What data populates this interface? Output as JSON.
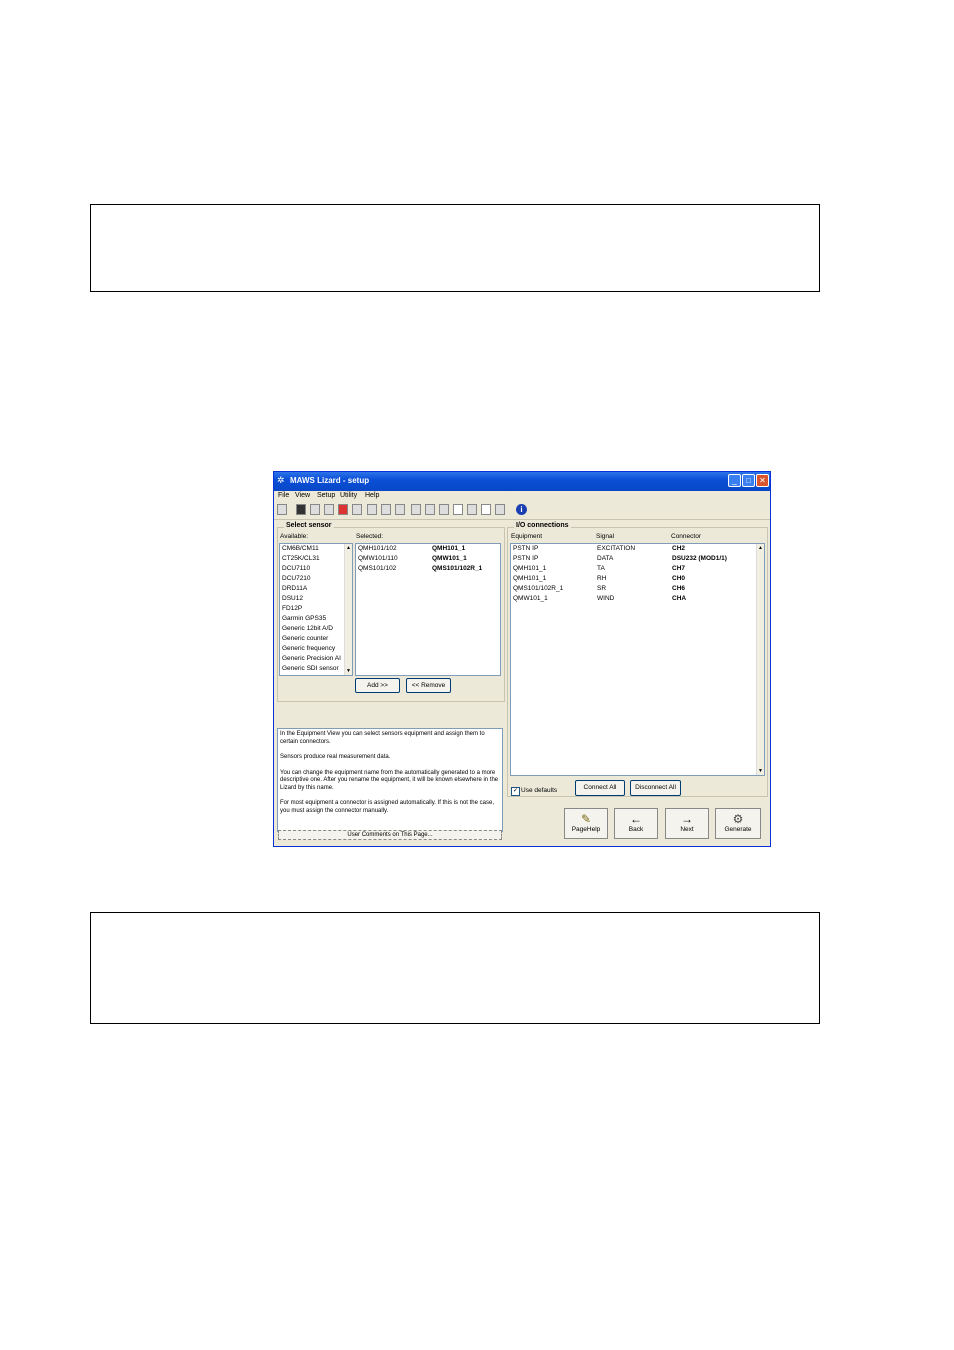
{
  "window": {
    "title": "MAWS Lizard - setup",
    "menu": [
      "File",
      "View",
      "Setup",
      "Utility",
      "Help"
    ],
    "info_icon": "i"
  },
  "select_sensor": {
    "title": "Select sensor",
    "available_label": "Available:",
    "selected_label": "Selected:",
    "available": [
      "CM6B/CM11",
      "CT25K/CL31",
      "DCU7110",
      "DCU7210",
      "DRD11A",
      "DSU12",
      "FD12P",
      "Garmin GPS35",
      "Generic 12bit A/D",
      "Generic counter",
      "Generic frequency",
      "Generic Precision AI",
      "Generic SDI sensor"
    ],
    "selected": [
      {
        "type": "QMH101/102",
        "name": "QMH101_1"
      },
      {
        "type": "QMW101/110",
        "name": "QMW101_1"
      },
      {
        "type": "QMS101/102",
        "name": "QMS101/102R_1"
      }
    ],
    "add_label": "Add >>",
    "remove_label": "<< Remove"
  },
  "help": {
    "p1": "In the Equipment View you can select sensors equipment and assign them to certain connectors.",
    "p2": "Sensors produce real measurement data.",
    "p3": "You can change the equipment name from the automatically generated to a more descriptive one. After you rename the equipment, it will be known elsewhere in the Lizard by this name.",
    "p4": "For most equipment a connector is assigned automatically. If this is not the case, you must assign the connector manually.",
    "user_comments": "User Comments on This Page..."
  },
  "io": {
    "title": "I/O connections",
    "col_equipment": "Equipment",
    "col_signal": "Signal",
    "col_connector": "Connector",
    "rows": [
      {
        "equipment": "PSTN IP",
        "signal": "EXCITATION",
        "connector": "CH2"
      },
      {
        "equipment": "PSTN IP",
        "signal": "DATA",
        "connector": "DSU232 (MOD1/1)"
      },
      {
        "equipment": "QMH101_1",
        "signal": "TA",
        "connector": "CH7"
      },
      {
        "equipment": "QMH101_1",
        "signal": "RH",
        "connector": "CH0"
      },
      {
        "equipment": "QMS101/102R_1",
        "signal": "SR",
        "connector": "CH6"
      },
      {
        "equipment": "QMW101_1",
        "signal": "WIND",
        "connector": "CHA"
      }
    ],
    "use_defaults": "Use defaults",
    "connect_all": "Connect All",
    "disconnect_all": "Disconnect All"
  },
  "nav": {
    "pagehelp": "PageHelp",
    "back": "Back",
    "next": "Next",
    "generate": "Generate"
  }
}
